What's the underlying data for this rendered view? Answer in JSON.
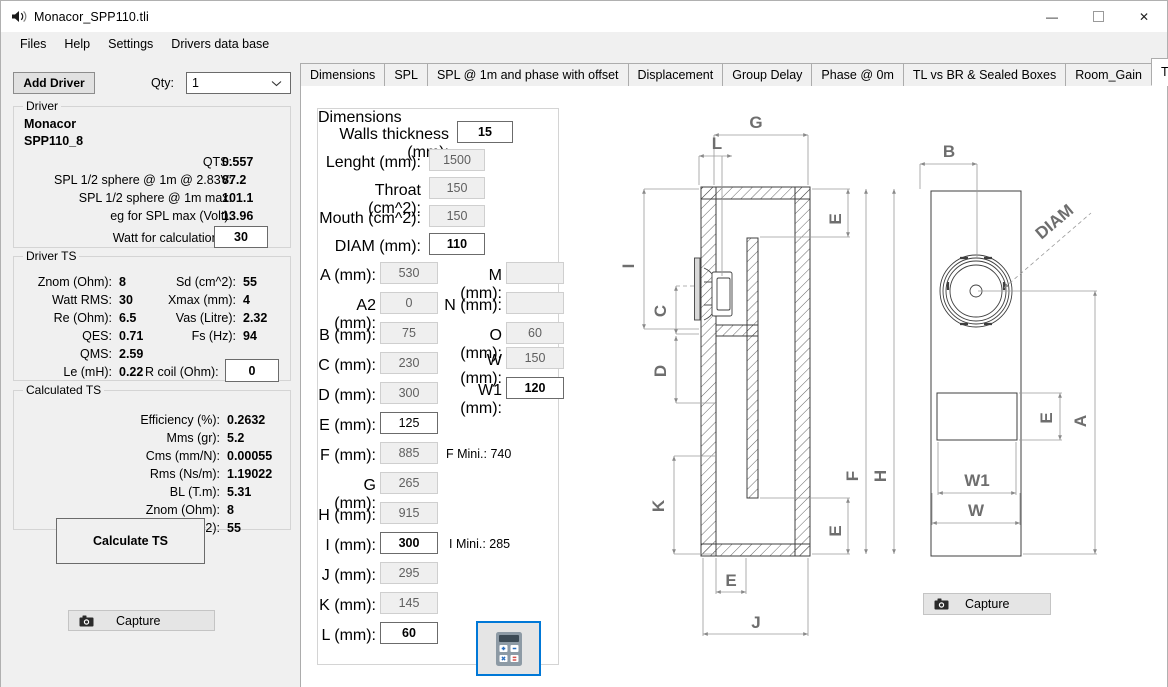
{
  "window": {
    "title": "Monacor_SPP110.tli",
    "icon": "speaker-icon",
    "minimize": "—",
    "maximize": "□",
    "close": "✕"
  },
  "menubar": {
    "items": [
      {
        "label": "Files"
      },
      {
        "label": "Help"
      },
      {
        "label": "Settings"
      },
      {
        "label": "Drivers data base"
      }
    ]
  },
  "toolbar": {
    "add_driver_label": "Add Driver",
    "qty_label": "Qty:",
    "qty_value": "1",
    "qty_chevron": "⌄"
  },
  "driver": {
    "legend": "Driver",
    "brand": "Monacor",
    "model": "SPP110_8",
    "rows": [
      {
        "label": "QTS:",
        "value": "0.557"
      },
      {
        "label": "SPL 1/2 sphere @ 1m @ 2.83V:",
        "value": "87.2"
      },
      {
        "label": "SPL 1/2 sphere @ 1m max:",
        "value": "101.1"
      },
      {
        "label": "eg for SPL max (Volt):",
        "value": "13.96"
      }
    ],
    "watt_label": "Watt for calculation:",
    "watt_value": "30"
  },
  "driver_ts": {
    "legend": "Driver TS",
    "left": [
      {
        "label": "Znom (Ohm):",
        "value": "8"
      },
      {
        "label": "Watt RMS:",
        "value": "30"
      },
      {
        "label": "Re (Ohm):",
        "value": "6.5"
      },
      {
        "label": "QES:",
        "value": "0.71"
      },
      {
        "label": "QMS:",
        "value": "2.59"
      },
      {
        "label": "Le (mH):",
        "value": "0.22"
      }
    ],
    "right": [
      {
        "label": "Sd (cm^2):",
        "value": "55"
      },
      {
        "label": "Xmax (mm):",
        "value": "4"
      },
      {
        "label": "Vas (Litre):",
        "value": "2.32"
      },
      {
        "label": "Fs (Hz):",
        "value": "94"
      }
    ],
    "rcoil_label": "R coil (Ohm):",
    "rcoil_value": "0"
  },
  "calculated_ts": {
    "legend": "Calculated TS",
    "rows": [
      {
        "label": "Efficiency (%):",
        "value": "0.2632"
      },
      {
        "label": "Mms (gr):",
        "value": "5.2"
      },
      {
        "label": "Cms (mm/N):",
        "value": "0.00055"
      },
      {
        "label": "Rms (Ns/m):",
        "value": "1.19022"
      },
      {
        "label": "BL (T.m):",
        "value": "5.31"
      },
      {
        "label": "Znom (Ohm):",
        "value": "8"
      },
      {
        "label": "Sd (cm^2):",
        "value": "55"
      }
    ]
  },
  "buttons": {
    "calculate_ts": "Calculate TS",
    "capture_left": "Capture",
    "capture_right": "Capture",
    "camera_icon": "camera-icon",
    "calculator_icon": "calculator-icon"
  },
  "tabs": [
    {
      "label": "Dimensions",
      "active": false
    },
    {
      "label": "SPL",
      "active": false
    },
    {
      "label": "SPL @ 1m and phase with offset",
      "active": false
    },
    {
      "label": "Displacement",
      "active": false
    },
    {
      "label": "Group Delay",
      "active": false
    },
    {
      "label": "Phase @ 0m",
      "active": false
    },
    {
      "label": "TL vs BR & Sealed Boxes",
      "active": false
    },
    {
      "label": "Room_Gain",
      "active": false
    },
    {
      "label": "TL drawing",
      "active": true
    }
  ],
  "dimensions": {
    "legend": "Dimensions",
    "walls_label": "Walls thickness (mm):",
    "walls_value": "15",
    "top_fields": [
      {
        "label": "Lenght (mm):",
        "value": "1500",
        "editable": false
      },
      {
        "label": "Throat (cm^2):",
        "value": "150",
        "editable": false
      },
      {
        "label": "Mouth (cm^2):",
        "value": "150",
        "editable": false
      },
      {
        "label": "DIAM (mm):",
        "value": "110",
        "editable": true
      }
    ],
    "left_fields": [
      {
        "label": "A (mm):",
        "value": "530",
        "editable": false
      },
      {
        "label": "A2 (mm):",
        "value": "0",
        "editable": false
      },
      {
        "label": "B (mm):",
        "value": "75",
        "editable": false
      },
      {
        "label": "C (mm):",
        "value": "230",
        "editable": false
      },
      {
        "label": "D (mm):",
        "value": "300",
        "editable": false
      },
      {
        "label": "E (mm):",
        "value": "125",
        "editable": true
      },
      {
        "label": "F (mm):",
        "value": "885",
        "editable": false
      },
      {
        "label": "G (mm):",
        "value": "265",
        "editable": false
      },
      {
        "label": "H (mm):",
        "value": "915",
        "editable": false
      },
      {
        "label": "I (mm):",
        "value": "300",
        "editable": true
      },
      {
        "label": "J (mm):",
        "value": "295",
        "editable": false
      },
      {
        "label": "K (mm):",
        "value": "145",
        "editable": false
      },
      {
        "label": "L (mm):",
        "value": "60",
        "editable": true
      }
    ],
    "right_fields": [
      {
        "label": "M (mm):",
        "value": "",
        "editable": false
      },
      {
        "label": "N (mm):",
        "value": "",
        "editable": false
      },
      {
        "label": "O (mm):",
        "value": "60",
        "editable": false
      },
      {
        "label": "W (mm):",
        "value": "150",
        "editable": false
      },
      {
        "label": "W1 (mm):",
        "value": "120",
        "editable": true
      }
    ],
    "f_mini": "F Mini.: 740",
    "i_mini": "I Mini.:  285"
  },
  "drawing": {
    "labels": {
      "G": "G",
      "L": "L",
      "E": "E",
      "I": "I",
      "C": "C",
      "D": "D",
      "K": "K",
      "F": "F",
      "H": "H",
      "J": "J",
      "B": "B",
      "DIAM": "DIAM",
      "A": "A",
      "W": "W",
      "W1": "W1"
    }
  },
  "colors": {
    "accent": "#0078d7",
    "window_bg": "#f0f0f0",
    "content_bg": "#ffffff",
    "drawing_line": "#3f3f3f",
    "dim_line": "#9a9a9a",
    "dim_text": "#6e6e6e"
  }
}
